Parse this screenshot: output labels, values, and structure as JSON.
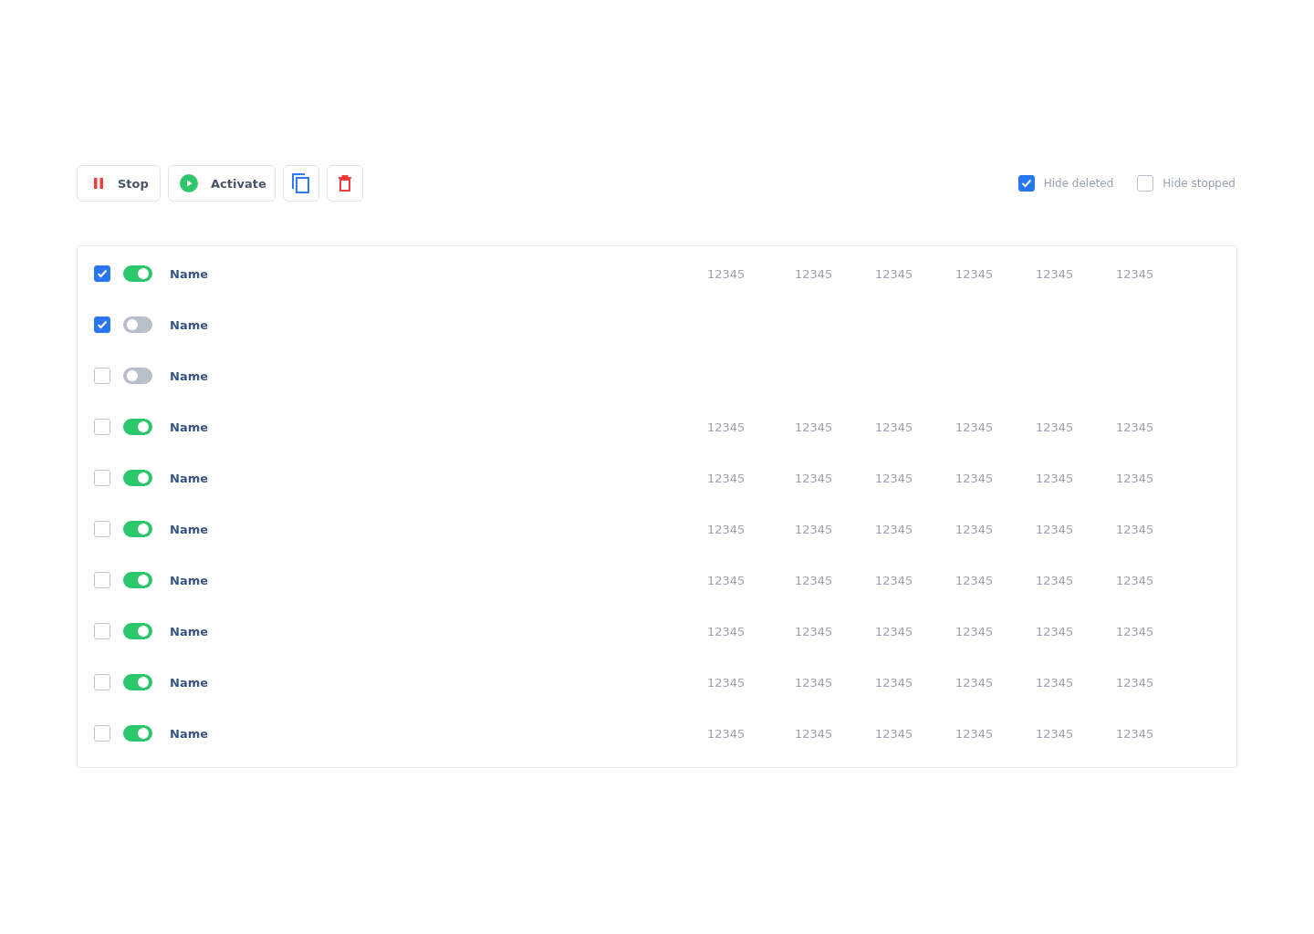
{
  "toolbar": {
    "buttons": [
      {
        "kind": "stop",
        "label": "Stop"
      },
      {
        "kind": "activate",
        "label": "Activate"
      },
      {
        "kind": "copy"
      },
      {
        "kind": "delete"
      }
    ],
    "filters": [
      {
        "label": "Hide deleted",
        "checked": true
      },
      {
        "label": "Hide stopped",
        "checked": false
      }
    ]
  },
  "table": {
    "rows": [
      {
        "checked": true,
        "on": true,
        "name": "Name",
        "values": [
          "12345",
          "12345",
          "12345",
          "12345",
          "12345",
          "12345"
        ]
      },
      {
        "checked": true,
        "on": false,
        "name": "Name"
      },
      {
        "checked": false,
        "on": false,
        "name": "Name"
      },
      {
        "checked": false,
        "on": true,
        "name": "Name",
        "values": [
          "12345",
          "12345",
          "12345",
          "12345",
          "12345",
          "12345"
        ]
      },
      {
        "checked": false,
        "on": true,
        "name": "Name",
        "values": [
          "12345",
          "12345",
          "12345",
          "12345",
          "12345",
          "12345"
        ]
      },
      {
        "checked": false,
        "on": true,
        "name": "Name",
        "values": [
          "12345",
          "12345",
          "12345",
          "12345",
          "12345",
          "12345"
        ]
      },
      {
        "checked": false,
        "on": true,
        "name": "Name",
        "values": [
          "12345",
          "12345",
          "12345",
          "12345",
          "12345",
          "12345"
        ]
      },
      {
        "checked": false,
        "on": true,
        "name": "Name",
        "values": [
          "12345",
          "12345",
          "12345",
          "12345",
          "12345",
          "12345"
        ]
      },
      {
        "checked": false,
        "on": true,
        "name": "Name",
        "values": [
          "12345",
          "12345",
          "12345",
          "12345",
          "12345",
          "12345"
        ]
      },
      {
        "checked": false,
        "on": true,
        "name": "Name",
        "values": [
          "12345",
          "12345",
          "12345",
          "12345",
          "12345",
          "12345"
        ]
      }
    ]
  }
}
